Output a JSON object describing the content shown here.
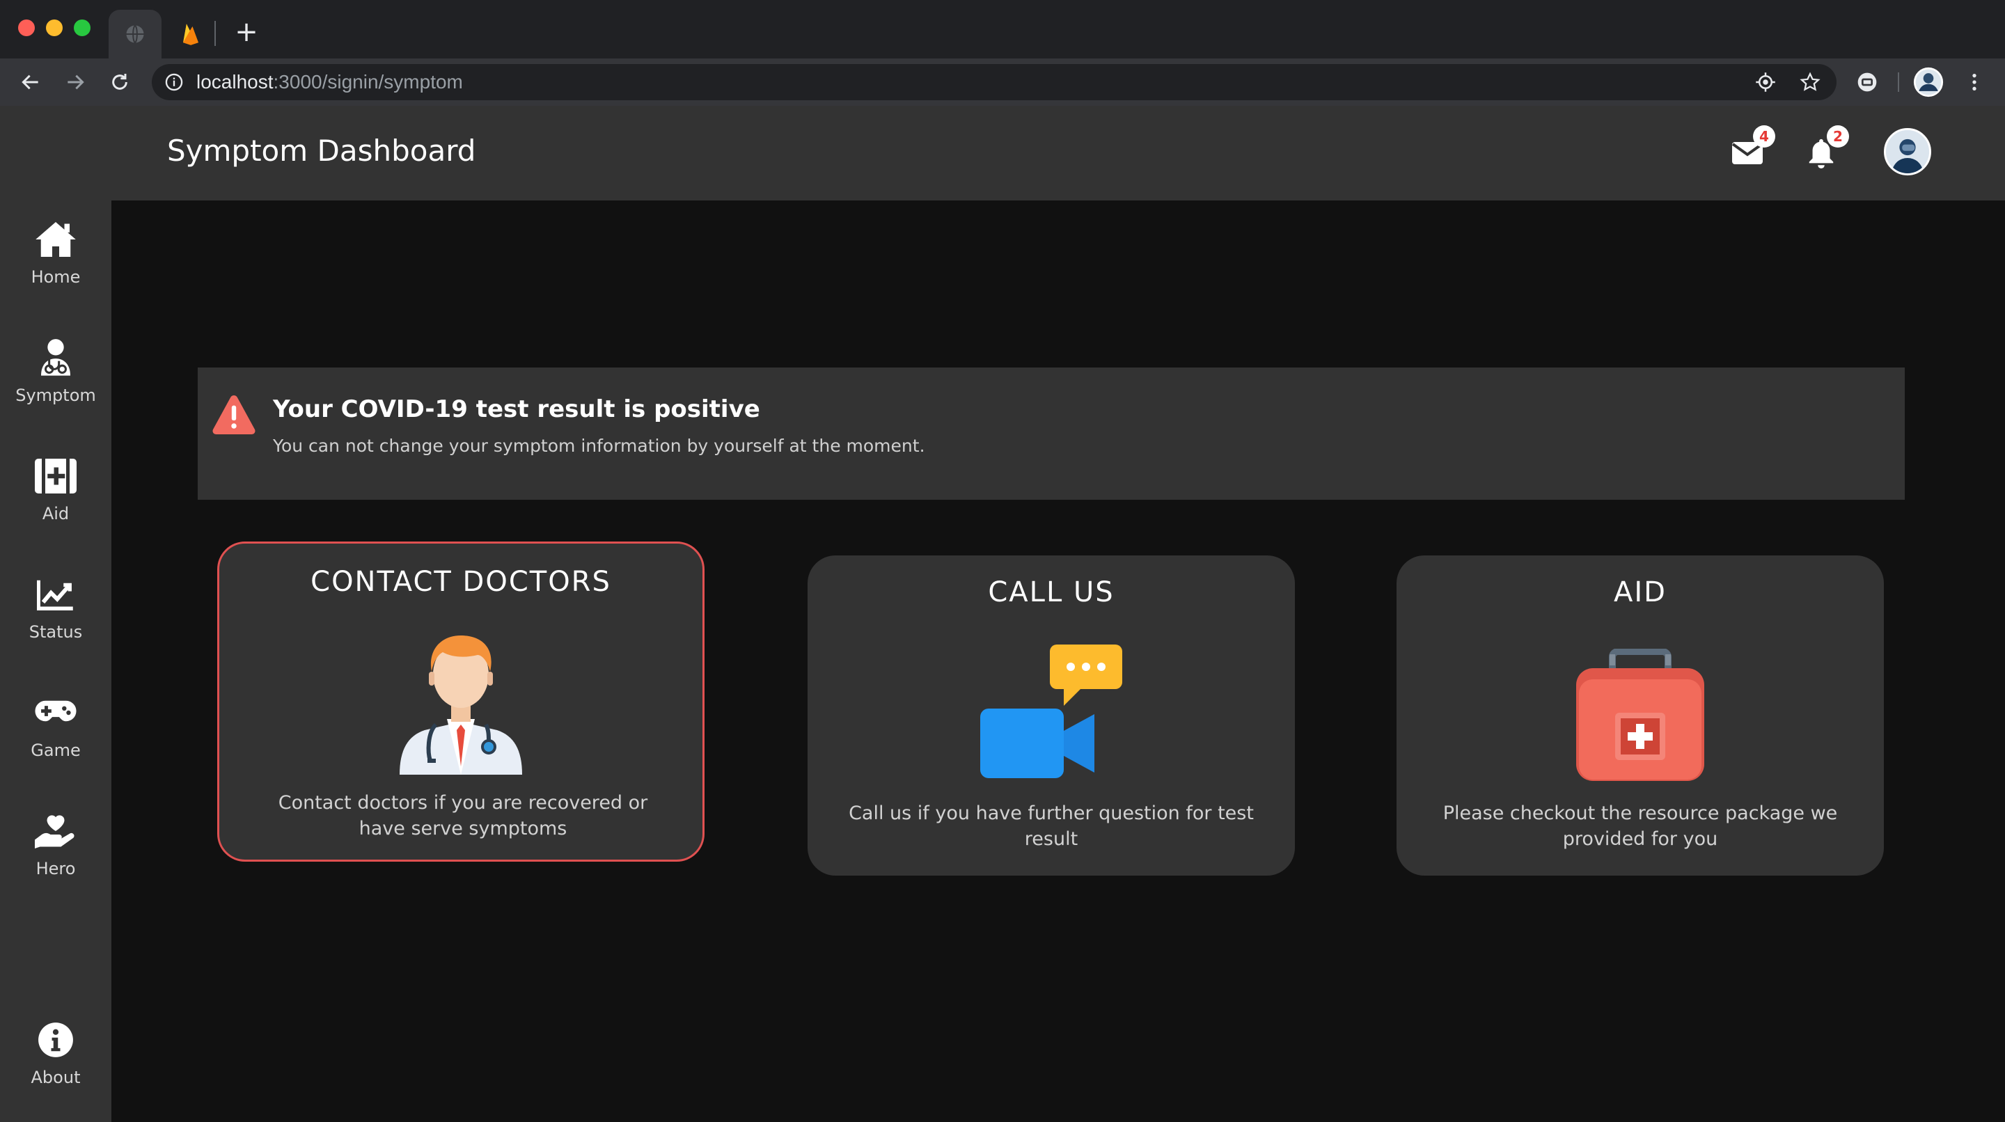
{
  "browser": {
    "url_host": "localhost",
    "url_path": ":3000/signin/symptom"
  },
  "sidebar": {
    "items": [
      {
        "label": "Home",
        "icon": "home-icon"
      },
      {
        "label": "Symptom",
        "icon": "symptom-icon"
      },
      {
        "label": "Aid",
        "icon": "first-aid-icon"
      },
      {
        "label": "Status",
        "icon": "chart-icon"
      },
      {
        "label": "Game",
        "icon": "gamepad-icon"
      },
      {
        "label": "Hero",
        "icon": "hand-heart-icon"
      }
    ],
    "about": {
      "label": "About",
      "icon": "info-icon"
    }
  },
  "header": {
    "title": "Symptom Dashboard",
    "mail_count": "4",
    "notification_count": "2"
  },
  "alert": {
    "title": "Your COVID-19 test result is positive",
    "message": "You can not change your symptom information by yourself at the moment.",
    "icon": "warning-icon",
    "color": "#f26b60"
  },
  "cards": [
    {
      "title": "CONTACT DOCTORS",
      "description": "Contact doctors if you are recovered or have serve symptoms",
      "icon": "doctor-icon",
      "selected": true
    },
    {
      "title": "CALL US",
      "description": "Call us if you have further question for test result",
      "icon": "video-call-icon",
      "selected": false
    },
    {
      "title": "AID",
      "description": "Please checkout the resource package we provided for you",
      "icon": "first-aid-kit-icon",
      "selected": false
    }
  ],
  "colors": {
    "sidebar_bg": "#333333",
    "content_bg": "#111111",
    "selected_border": "#e05151",
    "badge_text": "#e53935"
  }
}
